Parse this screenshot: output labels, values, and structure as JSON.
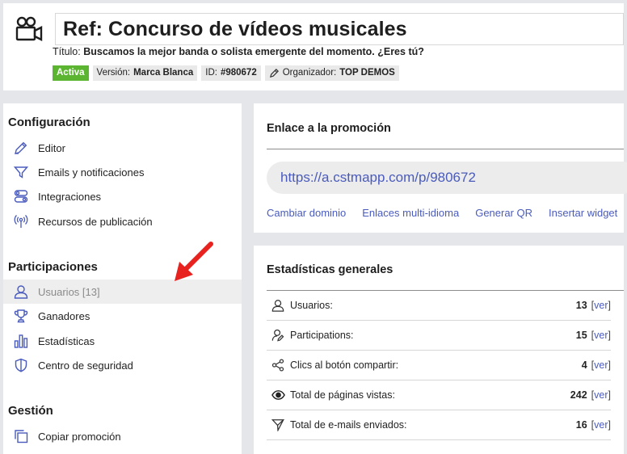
{
  "header": {
    "title": "Ref: Concurso de vídeos musicales",
    "subtitle_label": "Título:",
    "subtitle_value": "Buscamos la mejor banda o solista emergente del momento. ¿Eres tú?",
    "status": "Activa",
    "version_label": "Versión:",
    "version_value": "Marca Blanca",
    "id_label": "ID:",
    "id_value": "#980672",
    "organizer_label": "Organizador:",
    "organizer_value": "TOP DEMOS"
  },
  "sidebar": {
    "config_title": "Configuración",
    "config_items": [
      "Editor",
      "Emails y notificaciones",
      "Integraciones",
      "Recursos de publicación"
    ],
    "part_title": "Participaciones",
    "part_items": [
      "Usuarios [13]",
      "Ganadores",
      "Estadísticas",
      "Centro de seguridad"
    ],
    "gestion_title": "Gestión",
    "gestion_items": [
      "Copiar promoción"
    ]
  },
  "promo_link": {
    "title": "Enlace a la promoción",
    "url": "https://a.cstmapp.com/p/980672",
    "actions": [
      "Cambiar dominio",
      "Enlaces multi-idioma",
      "Generar QR",
      "Insertar widget"
    ]
  },
  "stats": {
    "title": "Estadísticas generales",
    "ver_label": "ver",
    "rows": [
      {
        "label": "Usuarios:",
        "value": "13"
      },
      {
        "label": "Participations:",
        "value": "15"
      },
      {
        "label": "Clics al botón compartir:",
        "value": "4"
      },
      {
        "label": "Total de páginas vistas:",
        "value": "242"
      },
      {
        "label": "Total de e-mails enviados:",
        "value": "16"
      }
    ]
  },
  "colors": {
    "accent": "#4a5bbd",
    "active": "#5cb531",
    "arrow": "#e8231f"
  }
}
